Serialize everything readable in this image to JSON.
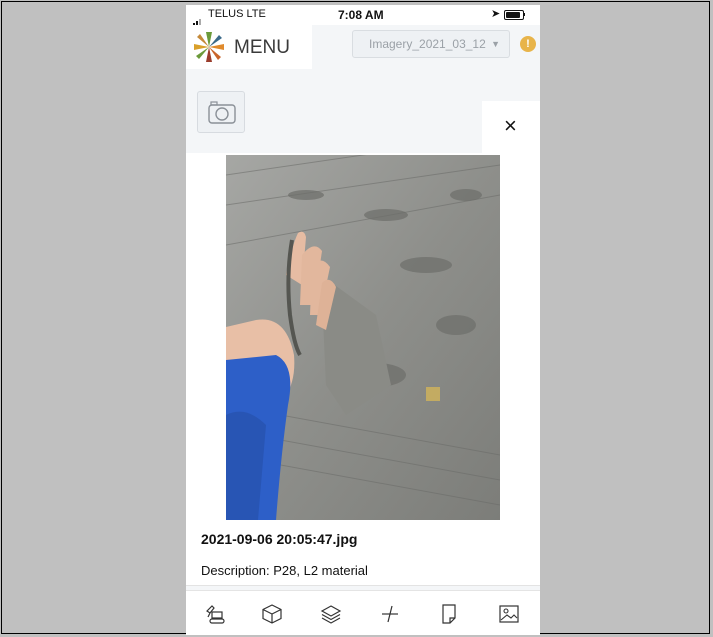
{
  "status_bar": {
    "carrier": "TELUS  LTE",
    "time": "7:08 AM"
  },
  "header": {
    "menu_label": "MENU",
    "imagery_select": "Imagery_2021_03_12",
    "warning_badge": "!"
  },
  "photo_modal": {
    "close_label": "×",
    "filename": "2021-09-06 20:05:47.jpg",
    "description": "Description: P28, L2 material"
  },
  "toolbar": {
    "items": [
      "excavator-icon",
      "cube-icon",
      "layers-icon",
      "measure-icon",
      "document-icon",
      "image-icon"
    ]
  },
  "colors": {
    "page_background": "#c0c0c0",
    "app_background": "#f4f6f8",
    "warning": "#e8b44a",
    "sleeve_blue": "#2d5fc8"
  }
}
